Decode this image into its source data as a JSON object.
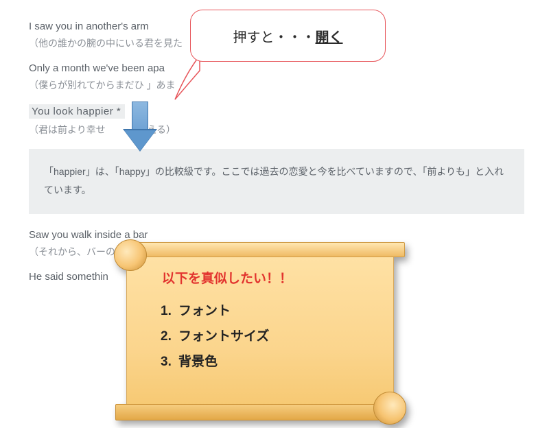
{
  "lines": [
    {
      "en": "I saw you in another's arm",
      "ja": "（他の誰かの腕の中にいる君を見た"
    },
    {
      "en": "Only a month we've been apa",
      "ja": "（僕らが別れてからまだひ       」あま"
    },
    {
      "en_hl": "You look happier *",
      "ja": "（君は前より幸せ            見える）"
    }
  ],
  "note": "「happier」は、「happy」の比較級です。ここでは過去の恋愛と今を比べていますので、「前よりも」と入れています。",
  "after": [
    {
      "en": "Saw you walk inside a bar",
      "ja": "（それから、バーの中へと入ってくのを見たんだ）"
    },
    {
      "en": "He said somethin",
      "ja": ""
    }
  ],
  "bubble": {
    "prefix": "押すと・・・",
    "bold": "開く"
  },
  "scroll": {
    "title": "以下を真似したい！！",
    "items": [
      "フォント",
      "フォントサイズ",
      "背景色"
    ]
  }
}
